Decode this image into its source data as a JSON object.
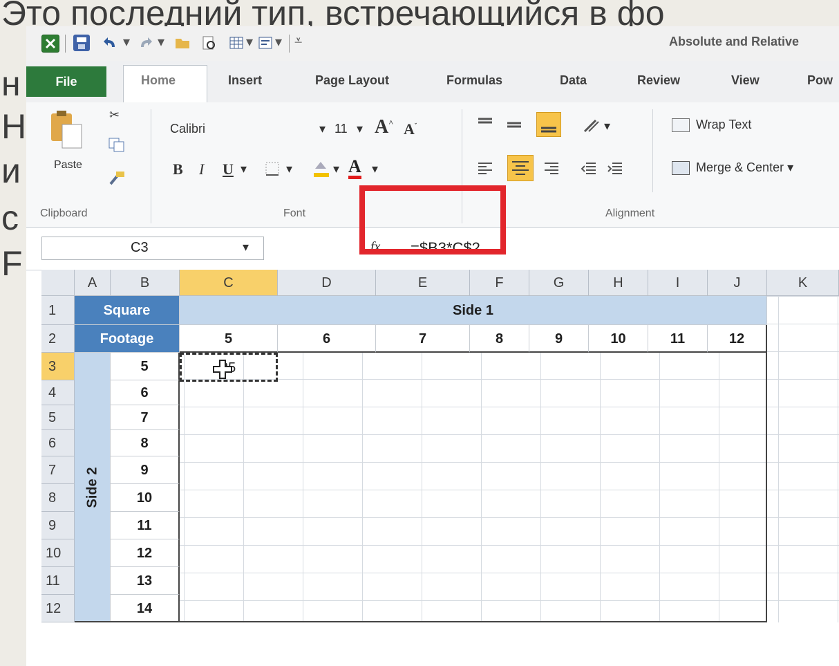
{
  "slide": {
    "line1": "Это последний тип, встречающийся в фо",
    "line2": "н",
    "line3": "Н",
    "line4": "и",
    "line5": "с",
    "line6": "F"
  },
  "window": {
    "title": "Absolute and Relative"
  },
  "tabs": [
    {
      "label": "File"
    },
    {
      "label": "Home"
    },
    {
      "label": "Insert"
    },
    {
      "label": "Page Layout"
    },
    {
      "label": "Formulas"
    },
    {
      "label": "Data"
    },
    {
      "label": "Review"
    },
    {
      "label": "View"
    },
    {
      "label": "Pow"
    }
  ],
  "ribbon": {
    "clipboard": {
      "paste": "Paste",
      "label": "Clipboard"
    },
    "font": {
      "name": "Calibri",
      "size": "11",
      "label": "Font",
      "bold": "B",
      "italic": "I",
      "underline": "U"
    },
    "alignment": {
      "wrap": "Wrap Text",
      "merge": "Merge & Center",
      "label": "Alignment"
    }
  },
  "formula_bar": {
    "name_box": "C3",
    "fx": "fx",
    "formula": "=$B3*C$2"
  },
  "colors": {
    "file_tab": "#2d7a3c",
    "header_dark": "#4a81bd",
    "header_light": "#c3d7ec",
    "highlight": "#e2262c",
    "selected_header": "#f8d06a"
  },
  "sheet": {
    "col_headers": [
      "A",
      "B",
      "C",
      "D",
      "E",
      "F",
      "G",
      "H",
      "I",
      "J",
      "K"
    ],
    "row_headers": [
      "1",
      "2",
      "3",
      "4",
      "5",
      "6",
      "7",
      "8",
      "9",
      "10",
      "11",
      "12"
    ],
    "corner_label_1": "Square",
    "corner_label_2": "Footage",
    "side1_label": "Side 1",
    "side2_label": "Side 2",
    "top_values": [
      "5",
      "6",
      "7",
      "8",
      "9",
      "10",
      "11",
      "12"
    ],
    "left_values": [
      "5",
      "6",
      "7",
      "8",
      "9",
      "10",
      "11",
      "12",
      "13",
      "14"
    ],
    "c3_value": "25"
  }
}
